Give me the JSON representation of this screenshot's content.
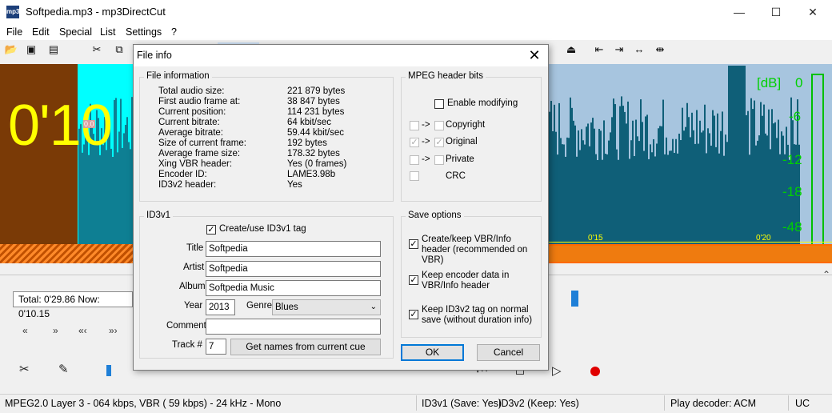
{
  "window": {
    "title": "Softpedia.mp3 - mp3DirectCut",
    "icon_text": "mp3"
  },
  "window_buttons": {
    "minimize": "—",
    "maximize": "☐",
    "close": "✕"
  },
  "menu": [
    "File",
    "Edit",
    "Special",
    "List",
    "Settings",
    "?"
  ],
  "wave": {
    "time_display": "0'10",
    "db_label": "[dB]",
    "db_scale": [
      "0",
      "-6",
      "-12",
      "-18",
      "-48"
    ],
    "marker": "0.0",
    "ticks": [
      "0'15",
      "0'20"
    ]
  },
  "lower": {
    "time_box": "Total: 0'29.86   Now: 0'10.15",
    "nav": [
      "«",
      "»",
      "«‹",
      "»›"
    ]
  },
  "status": {
    "format": "MPEG2.0 Layer 3 - 064 kbps, VBR ( 59 kbps) - 24 kHz - Mono",
    "id3v1": "ID3v1 (Save: Yes)",
    "id3v2": "ID3v2 (Keep: Yes)",
    "decoder": "Play decoder: ACM",
    "uc": "UC"
  },
  "dialog": {
    "title": "File info",
    "file_information": {
      "heading": "File information",
      "rows": [
        {
          "k": "Total audio size:",
          "v": "221 879 bytes"
        },
        {
          "k": "First audio frame at:",
          "v": "38 847 bytes"
        },
        {
          "k": "Current position:",
          "v": "114 231 bytes"
        },
        {
          "k": "Current bitrate:",
          "v": "64 kbit/sec"
        },
        {
          "k": "Average bitrate:",
          "v": "59.44 kbit/sec"
        },
        {
          "k": "Size of current frame:",
          "v": "192 bytes"
        },
        {
          "k": "Average frame size:",
          "v": "178.32 bytes"
        },
        {
          "k": "Xing VBR header:",
          "v": "Yes (0 frames)"
        },
        {
          "k": "Encoder ID:",
          "v": "LAME3.98b"
        },
        {
          "k": "ID3v2 header:",
          "v": "Yes"
        }
      ]
    },
    "mpeg_bits": {
      "heading": "MPEG header bits",
      "enable_modifying": "Enable modifying",
      "arrow": "->",
      "copyright": "Copyright",
      "original": "Original",
      "private": "Private",
      "crc": "CRC"
    },
    "id3v1": {
      "heading": "ID3v1",
      "create_label": "Create/use ID3v1 tag",
      "title_label": "Title",
      "title_value": "Softpedia",
      "artist_label": "Artist",
      "artist_value": "Softpedia",
      "album_label": "Album",
      "album_value": "Softpedia Music",
      "year_label": "Year",
      "year_value": "2013",
      "genre_label": "Genre",
      "genre_value": "Blues",
      "comment_label": "Comment",
      "comment_value": "",
      "track_label": "Track #",
      "track_value": "7",
      "get_names_button": "Get names from current cue"
    },
    "save_options": {
      "heading": "Save options",
      "opt1": "Create/keep VBR/Info header (recommended on VBR)",
      "opt2": "Keep encoder data in VBR/Info header",
      "opt3": "Keep ID3v2 tag on normal save (without duration info)"
    },
    "ok": "OK",
    "cancel": "Cancel"
  }
}
